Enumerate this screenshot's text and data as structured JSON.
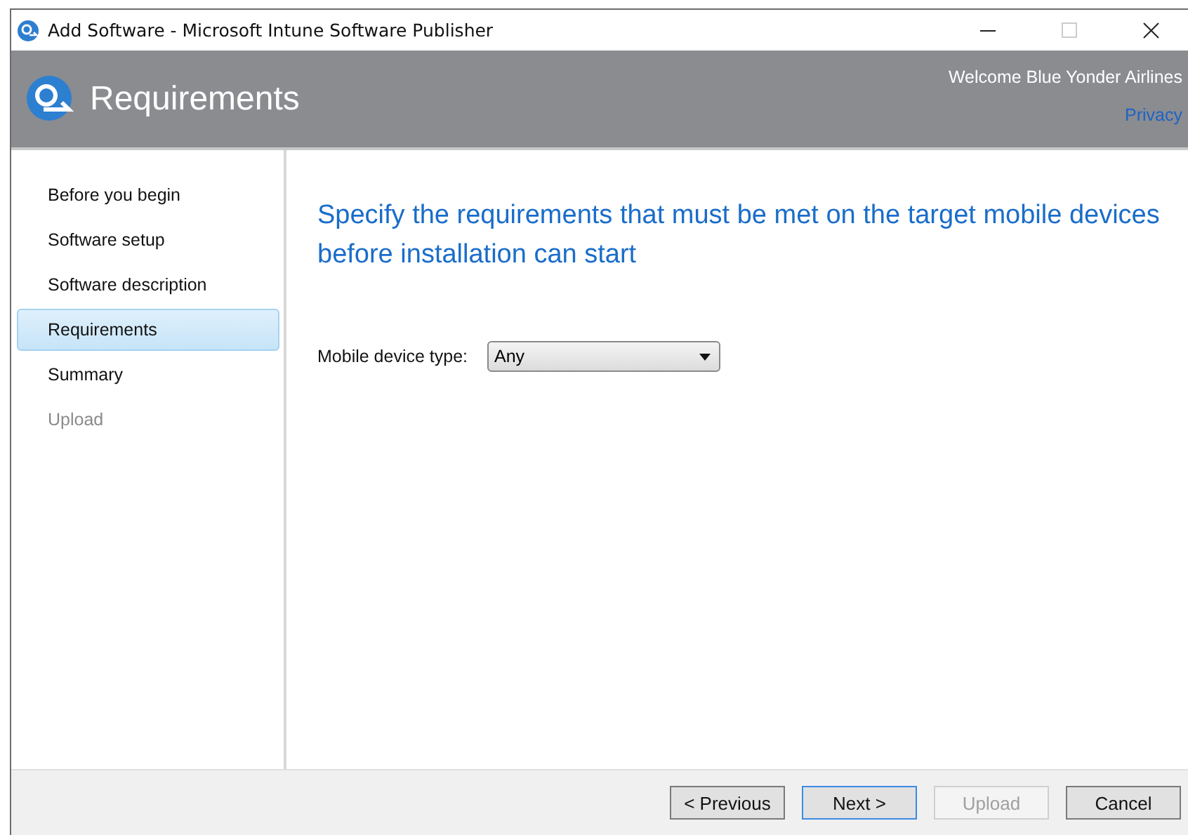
{
  "window": {
    "title": "Add Software - Microsoft Intune Software Publisher"
  },
  "header": {
    "title": "Requirements",
    "welcome": "Welcome Blue Yonder Airlines",
    "privacy_link": "Privacy"
  },
  "steps": [
    {
      "label": "Before you begin",
      "selected": false,
      "disabled": false
    },
    {
      "label": "Software setup",
      "selected": false,
      "disabled": false
    },
    {
      "label": "Software description",
      "selected": false,
      "disabled": false
    },
    {
      "label": "Requirements",
      "selected": true,
      "disabled": false
    },
    {
      "label": "Summary",
      "selected": false,
      "disabled": false
    },
    {
      "label": "Upload",
      "selected": false,
      "disabled": true
    }
  ],
  "content": {
    "heading": "Specify the requirements that must be met on the target mobile devices before installation can start",
    "field_label": "Mobile device type:",
    "field_value": "Any"
  },
  "buttons": [
    {
      "label": "< Previous",
      "default": false,
      "disabled": false
    },
    {
      "label": "Next >",
      "default": true,
      "disabled": false
    },
    {
      "label": "Upload",
      "default": false,
      "disabled": true
    },
    {
      "label": "Cancel",
      "default": false,
      "disabled": false
    }
  ]
}
